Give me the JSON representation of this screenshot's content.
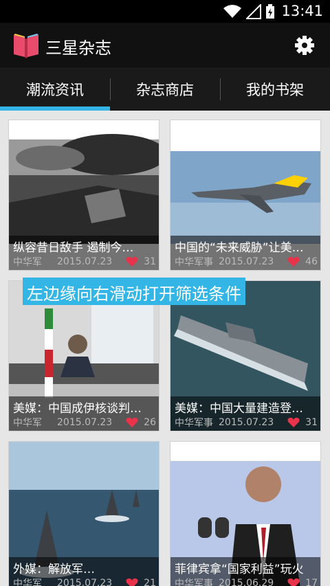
{
  "status_bar": {
    "time": "13:41",
    "icons": [
      "wifi-icon",
      "signal-icon",
      "battery-charging-icon"
    ]
  },
  "app_bar": {
    "title": "三星杂志",
    "logo_icon": "book-icon",
    "settings_icon": "gear-icon"
  },
  "tabs": [
    {
      "label": "潮流资讯",
      "selected": true
    },
    {
      "label": "杂志商店",
      "selected": false
    },
    {
      "label": "我的书架",
      "selected": false
    }
  ],
  "accent_color": "#33b5e5",
  "hint_text": "左边缘向右滑动打开筛选条件",
  "articles": [
    {
      "headline": "纵容昔日敌手 遏制今…",
      "source": "中华军",
      "date": "2015.07.23",
      "likes": "31"
    },
    {
      "headline": "中国的“未来威胁”让美…",
      "source": "中华军事",
      "date": "2015.07.23",
      "likes": "46"
    },
    {
      "headline": "美媒：中国成伊核谈判…",
      "source": "中华军",
      "date": "2015.07.23",
      "likes": "26"
    },
    {
      "headline": "美媒：中国大量建造登…",
      "source": "中华军事",
      "date": "2015.07.23",
      "likes": "31"
    },
    {
      "headline": "外媒：解放军…",
      "source": "中华军",
      "date": "2015.07.23",
      "likes": "21"
    },
    {
      "headline": "菲律宾拿“国家利益”玩火",
      "source": "中华军事",
      "date": "2015.06.29",
      "likes": "17"
    }
  ]
}
